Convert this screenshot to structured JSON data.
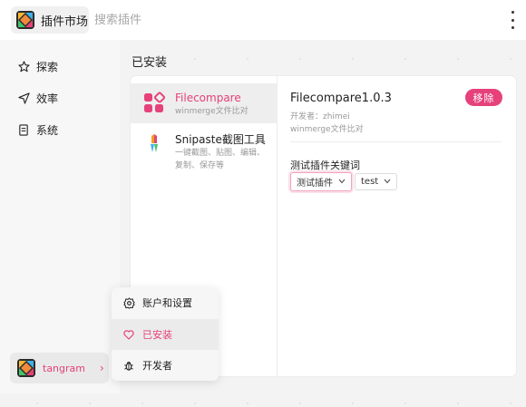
{
  "header": {
    "app_title": "插件市场",
    "search_placeholder": "搜索插件"
  },
  "sidebar": {
    "items": [
      {
        "label": "探索",
        "icon": "star-icon"
      },
      {
        "label": "效率",
        "icon": "send-icon"
      },
      {
        "label": "系统",
        "icon": "list-icon"
      }
    ],
    "user": {
      "name": "tangram",
      "chevron": "›"
    }
  },
  "main": {
    "section_title": "已安装",
    "plugins": [
      {
        "name": "Filecompare",
        "desc": "winmerge文件比对",
        "active": true
      },
      {
        "name": "Snipaste截图工具",
        "desc": "一键截图、贴图、编辑、复制、保存等",
        "desc_lines": [
          "一键截图、贴图、编辑、",
          "复制、保存等"
        ]
      }
    ],
    "detail": {
      "title": "Filecompare1.0.3",
      "author": "开发者：zhimei",
      "description": "winmerge文件比对",
      "remove_label": "移除",
      "keyword_title": "测试插件关键词",
      "keyword_select": "测试插件",
      "secondary_select": "test"
    }
  },
  "menu": {
    "items": [
      {
        "label": "账户和设置",
        "icon": "gear-icon"
      },
      {
        "label": "已安装",
        "icon": "heart-icon",
        "active": true
      },
      {
        "label": "开发者",
        "icon": "bug-icon"
      }
    ]
  },
  "colors": {
    "accent": "#e6417a",
    "accent_light": "#fbe1ea"
  }
}
